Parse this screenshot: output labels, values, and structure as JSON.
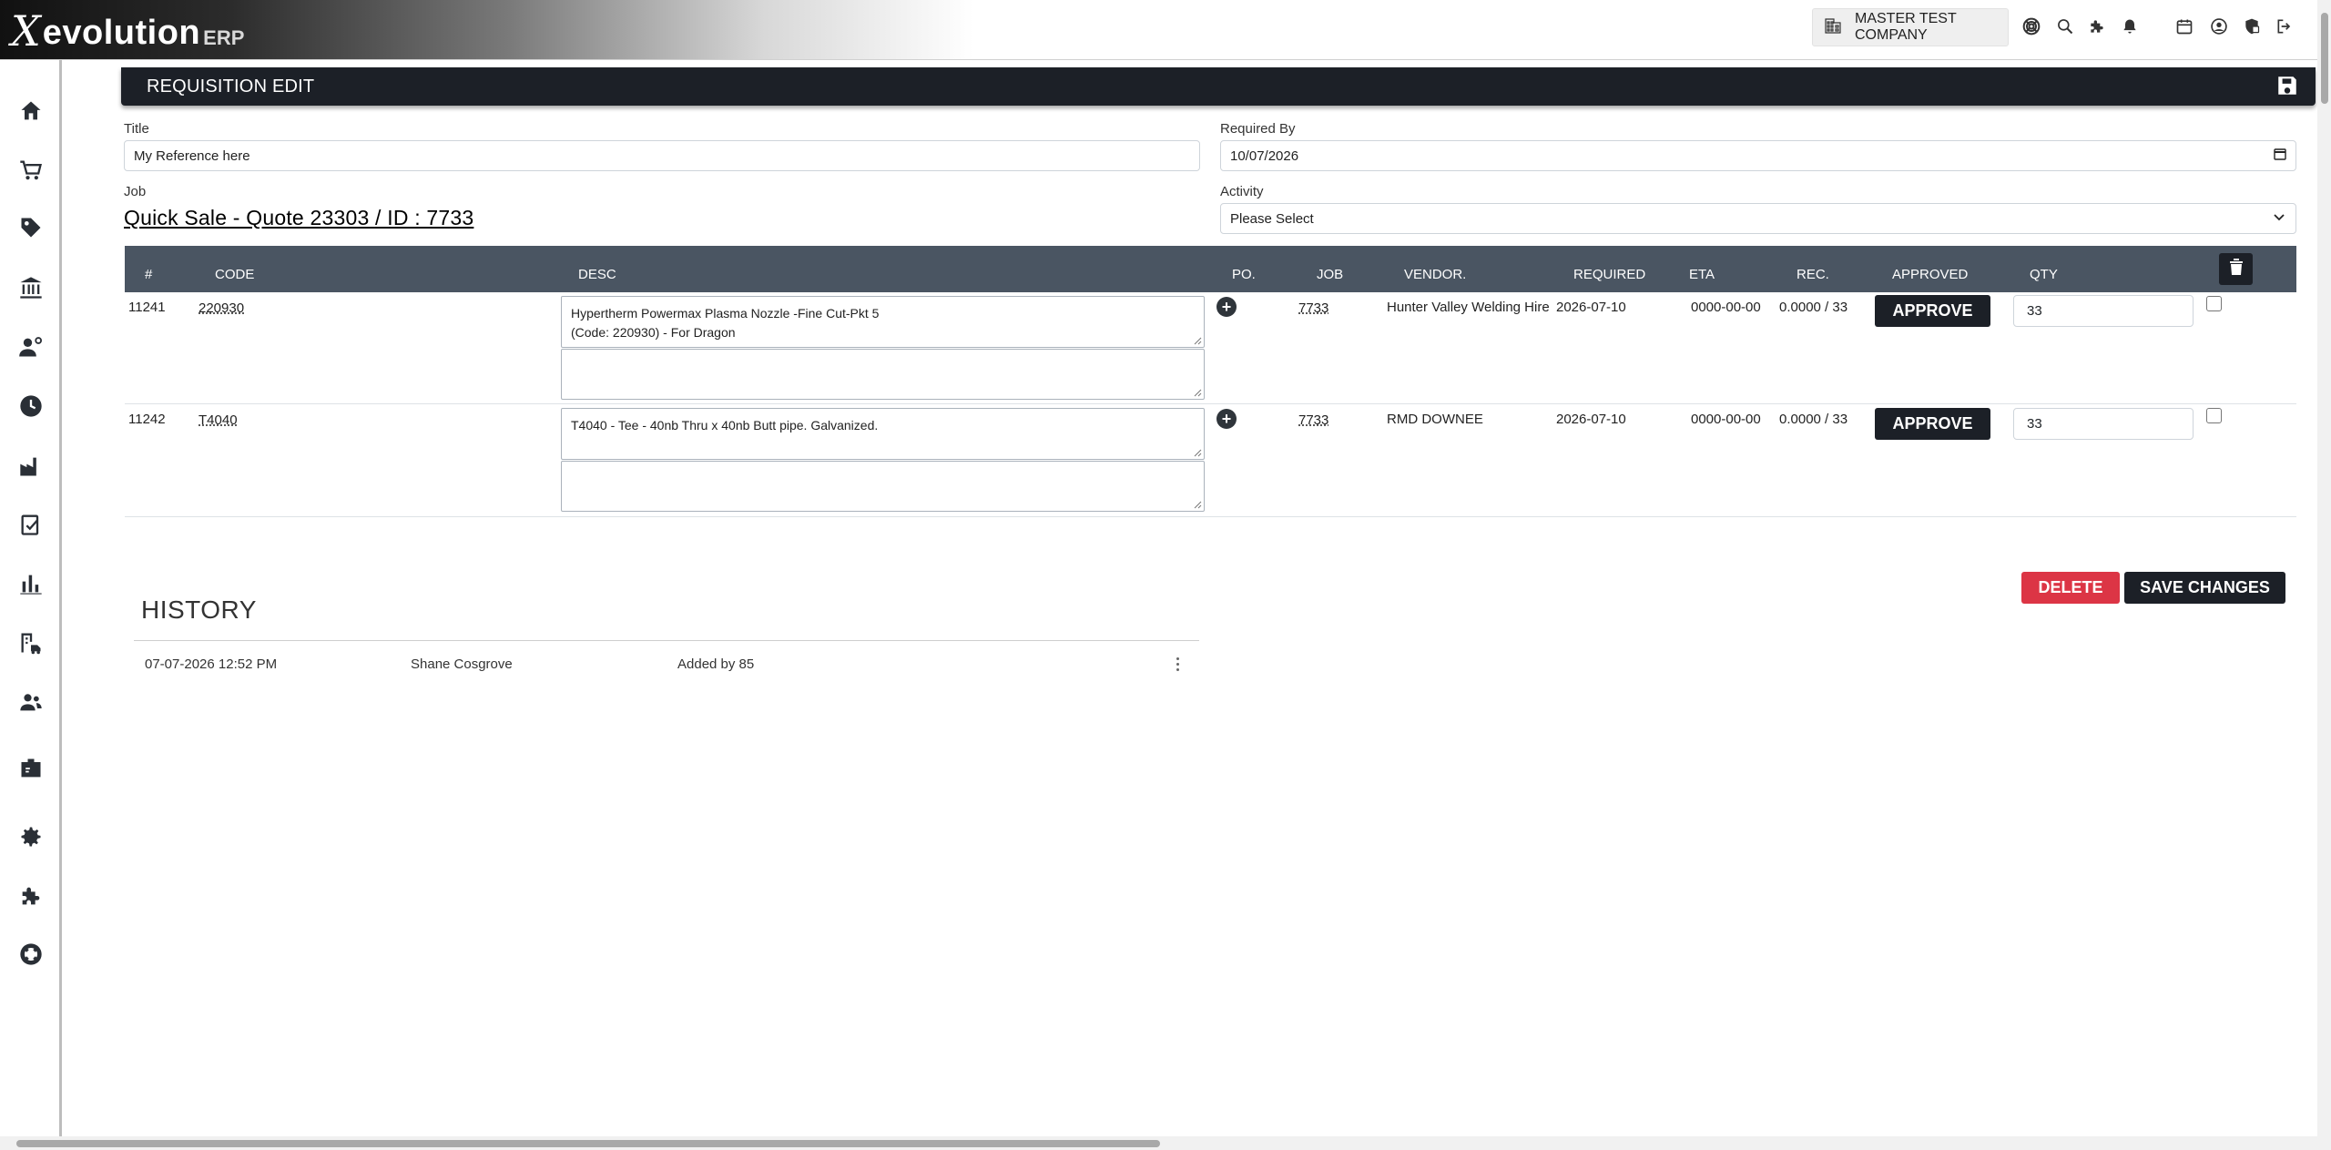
{
  "brand": {
    "logo_main": "evolution",
    "logo_suffix": "ERP"
  },
  "topbar": {
    "company": "MASTER TEST COMPANY"
  },
  "page": {
    "title": "REQUISITION EDIT"
  },
  "form": {
    "title_label": "Title",
    "title_value": "My Reference here",
    "required_by_label": "Required By",
    "required_by_value": "10/07/2026",
    "job_label": "Job",
    "job_value": "Quick Sale - Quote 23303 / ID : 7733",
    "activity_label": "Activity",
    "activity_value": "Please Select"
  },
  "table": {
    "headers": {
      "num": "#",
      "code": "CODE",
      "desc": "DESC",
      "po": "PO.",
      "job": "JOB",
      "vendor": "VENDOR.",
      "required": "REQUIRED",
      "eta": "ETA",
      "rec": "REC.",
      "approved": "APPROVED",
      "qty": "QTY"
    },
    "rows": [
      {
        "id": "11241",
        "code": "220930",
        "desc_line1": "Hypertherm Powermax Plasma Nozzle -Fine Cut-Pkt 5",
        "desc_line2": "(Code: 220930) - For Dragon",
        "job": "7733",
        "vendor": "Hunter Valley Welding Hire",
        "required": "2026-07-10",
        "eta": "0000-00-00",
        "rec": "0.0000 / 33",
        "approve_label": "APPROVE",
        "qty": "33"
      },
      {
        "id": "11242",
        "code": "T4040",
        "desc_line1": "T4040 - Tee - 40nb Thru x 40nb Butt pipe. Galvanized.",
        "desc_line2": "",
        "job": "7733",
        "vendor": "RMD DOWNEE",
        "required": "2026-07-10",
        "eta": "0000-00-00",
        "rec": "0.0000 / 33",
        "approve_label": "APPROVE",
        "qty": "33"
      }
    ]
  },
  "actions": {
    "delete_label": "DELETE",
    "save_label": "SAVE CHANGES"
  },
  "history": {
    "title": "HISTORY",
    "entries": [
      {
        "datetime": "07-07-2026 12:52 PM",
        "user": "Shane Cosgrove",
        "note": "Added by 85"
      }
    ]
  },
  "icons": {
    "sidebar": [
      "home-icon",
      "cart-icon",
      "tag-icon",
      "bank-icon",
      "user-gear-icon",
      "clock-icon",
      "factory-icon",
      "clipboard-check-icon",
      "bar-chart-icon",
      "building-truck-icon",
      "users-icon",
      "id-card-icon",
      "gear-icon",
      "puzzle-icon",
      "lifebuoy-icon"
    ],
    "accent_dark": "#1c2027",
    "header_row": "#4a5562",
    "danger": "#dc3545"
  }
}
